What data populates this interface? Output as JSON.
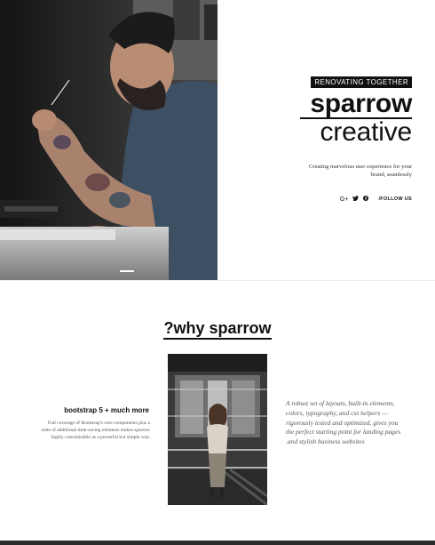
{
  "hero": {
    "kicker": "RENOVATING TOGETHER",
    "brand_bold": "sparrow",
    "brand_light": "creative",
    "tagline": "Creating marvelous user experience for your brand, seamlessly",
    "social": {
      "follow_label": "/FOLLOW US",
      "icons": [
        "google-plus-icon",
        "twitter-icon",
        "facebook-icon"
      ]
    },
    "slider": {
      "slides": 3,
      "active": 3
    }
  },
  "why": {
    "title": "?why sparrow",
    "feature_title": "bootstrap 5 + much more",
    "feature_text": "Full coverage of Bootstrap's core components plus a suite of additional time-saving elements makes sparrow highly customizable as a powerful but simple way.",
    "description": "A robust set of layouts, built-in elements, colors, typography, and css helpers — rigorously tested and optimized, gives you the perfect starting point for landing pages .and stylish business websites"
  },
  "colors": {
    "text": "#111111",
    "muted": "#555555",
    "background": "#ffffff"
  }
}
